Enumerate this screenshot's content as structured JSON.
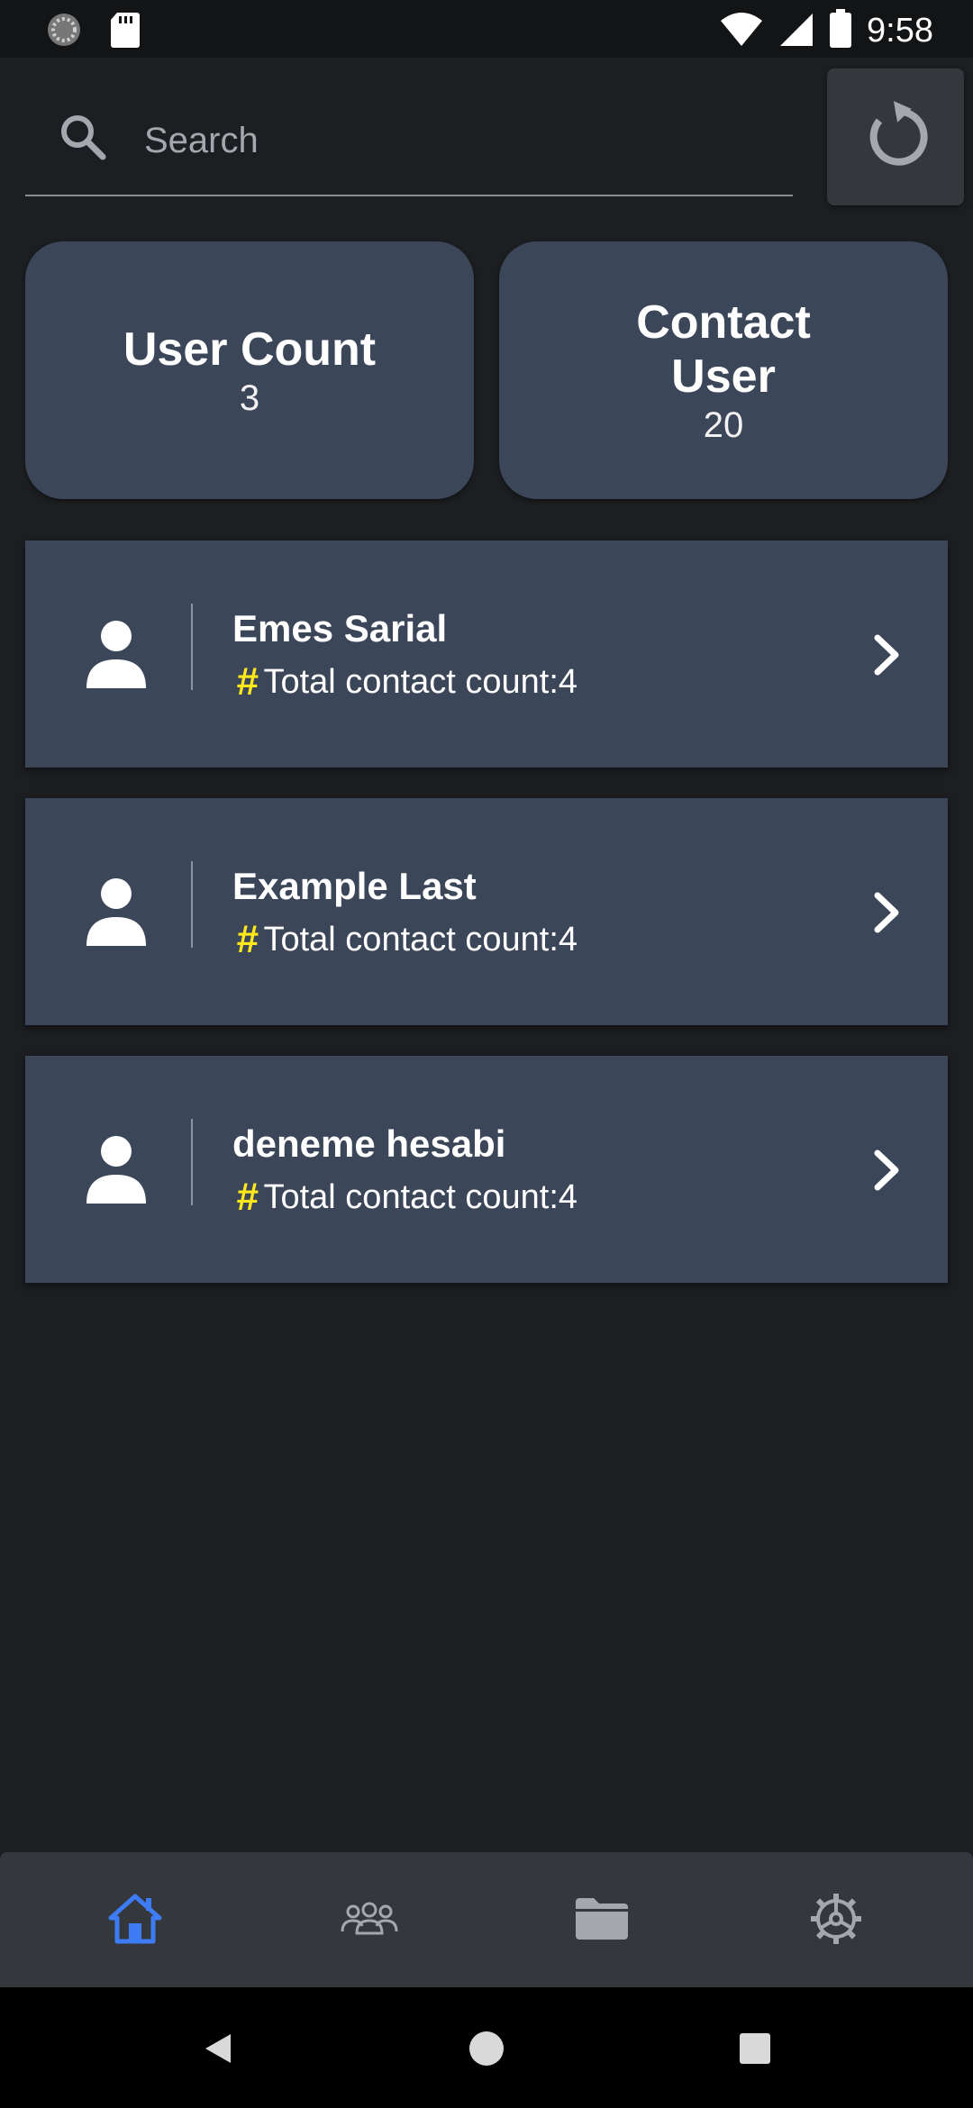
{
  "status_bar": {
    "time": "9:58"
  },
  "search": {
    "placeholder": "Search",
    "value": ""
  },
  "stats": [
    {
      "title": "User Count",
      "value": "3"
    },
    {
      "title": "Contact User",
      "value": "20"
    }
  ],
  "users": [
    {
      "name": "Emes Sarial",
      "count_text": "Total contact count:4"
    },
    {
      "name": "Example Last",
      "count_text": "Total contact count:4"
    },
    {
      "name": "deneme hesabi",
      "count_text": "Total contact count:4"
    }
  ],
  "bottom_nav": {
    "items": [
      "home-icon",
      "users-icon",
      "folder-icon",
      "settings-icon"
    ],
    "active_index": 0
  },
  "colors": {
    "background": "#1c1e21",
    "card": "#3c4659",
    "accent_active": "#3d7cf5",
    "hash": "#ffe81a",
    "nav_bar": "#34373b"
  }
}
